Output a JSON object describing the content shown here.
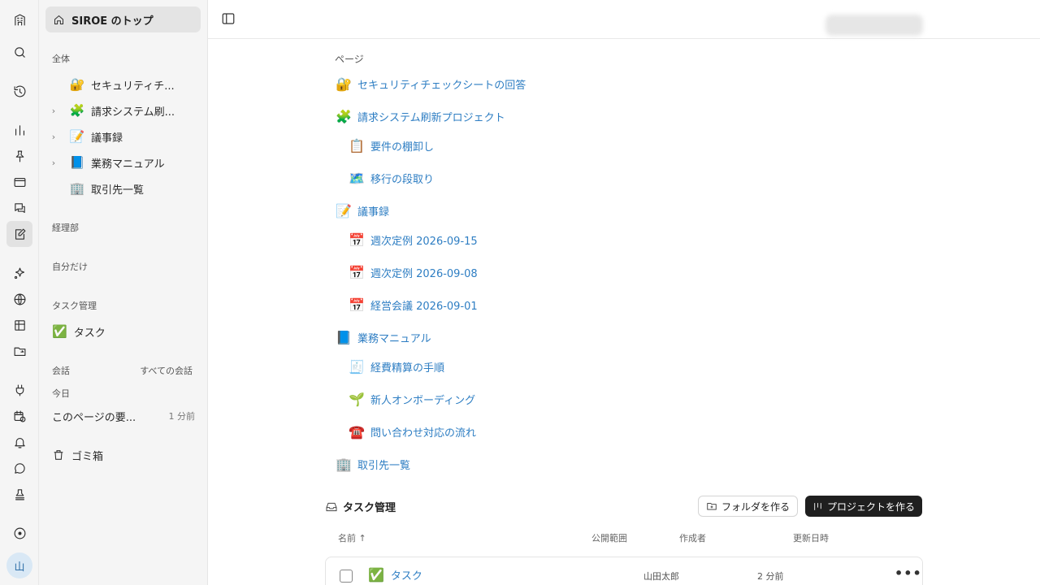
{
  "sidebar": {
    "home_label": "SIROE のトップ",
    "sections": {
      "all": "全体",
      "accounting": "経理部",
      "private": "自分だけ",
      "task_mgmt": "タスク管理",
      "conversations": "会話",
      "all_conversations": "すべての会話",
      "today": "今日"
    },
    "tree": [
      {
        "emoji": "🔐",
        "label": "セキュリティチ...",
        "expandable": false
      },
      {
        "emoji": "🧩",
        "label": "請求システム刷...",
        "expandable": true
      },
      {
        "emoji": "📝",
        "label": "議事録",
        "expandable": true
      },
      {
        "emoji": "📘",
        "label": "業務マニュアル",
        "expandable": true
      },
      {
        "emoji": "🏢",
        "label": "取引先一覧",
        "expandable": false
      }
    ],
    "task_item": {
      "emoji": "✅",
      "label": "タスク"
    },
    "conversation": {
      "label": "このページの要...",
      "time": "1 分前"
    },
    "trash_label": "ゴミ箱"
  },
  "rail": {
    "icons": [
      "building-icon",
      "search-icon",
      "history-icon",
      "chart-icon",
      "pin-icon",
      "browser-icon",
      "chat-bubbles-icon",
      "edit-note-icon",
      "sparkle-icon",
      "globe-icon",
      "table-icon",
      "folder-sync-icon",
      "plug-icon",
      "calendar-clock-icon",
      "bell-icon",
      "message-icon",
      "stamp-icon",
      "circle-dot-icon"
    ],
    "avatar": "山"
  },
  "main": {
    "pages_label": "ページ",
    "pages": [
      {
        "emoji": "🔐",
        "label": "セキュリティチェックシートの回答",
        "level": 0
      },
      {
        "emoji": "🧩",
        "label": "請求システム刷新プロジェクト",
        "level": 0
      },
      {
        "emoji": "📋",
        "label": "要件の棚卸し",
        "level": 1
      },
      {
        "emoji": "🗺️",
        "label": "移行の段取り",
        "level": 1
      },
      {
        "emoji": "📝",
        "label": "議事録",
        "level": 0
      },
      {
        "emoji": "📅",
        "label": "週次定例 2026-09-15",
        "level": 1
      },
      {
        "emoji": "📅",
        "label": "週次定例 2026-09-08",
        "level": 1
      },
      {
        "emoji": "📅",
        "label": "経営会議 2026-09-01",
        "level": 1
      },
      {
        "emoji": "📘",
        "label": "業務マニュアル",
        "level": 0
      },
      {
        "emoji": "🧾",
        "label": "経費精算の手順",
        "level": 1
      },
      {
        "emoji": "🌱",
        "label": "新人オンボーディング",
        "level": 1
      },
      {
        "emoji": "☎️",
        "label": "問い合わせ対応の流れ",
        "level": 1
      },
      {
        "emoji": "🏢",
        "label": "取引先一覧",
        "level": 0
      }
    ],
    "task_section": {
      "title": "タスク管理",
      "folder_button": "フォルダを作る",
      "project_button": "プロジェクトを作る",
      "columns": {
        "name": "名前",
        "visibility": "公開範囲",
        "author": "作成者",
        "updated": "更新日時"
      },
      "rows": [
        {
          "emoji": "✅",
          "name": "タスク",
          "visibility": "",
          "author": "山田太郎",
          "updated": "2 分前"
        }
      ]
    }
  }
}
